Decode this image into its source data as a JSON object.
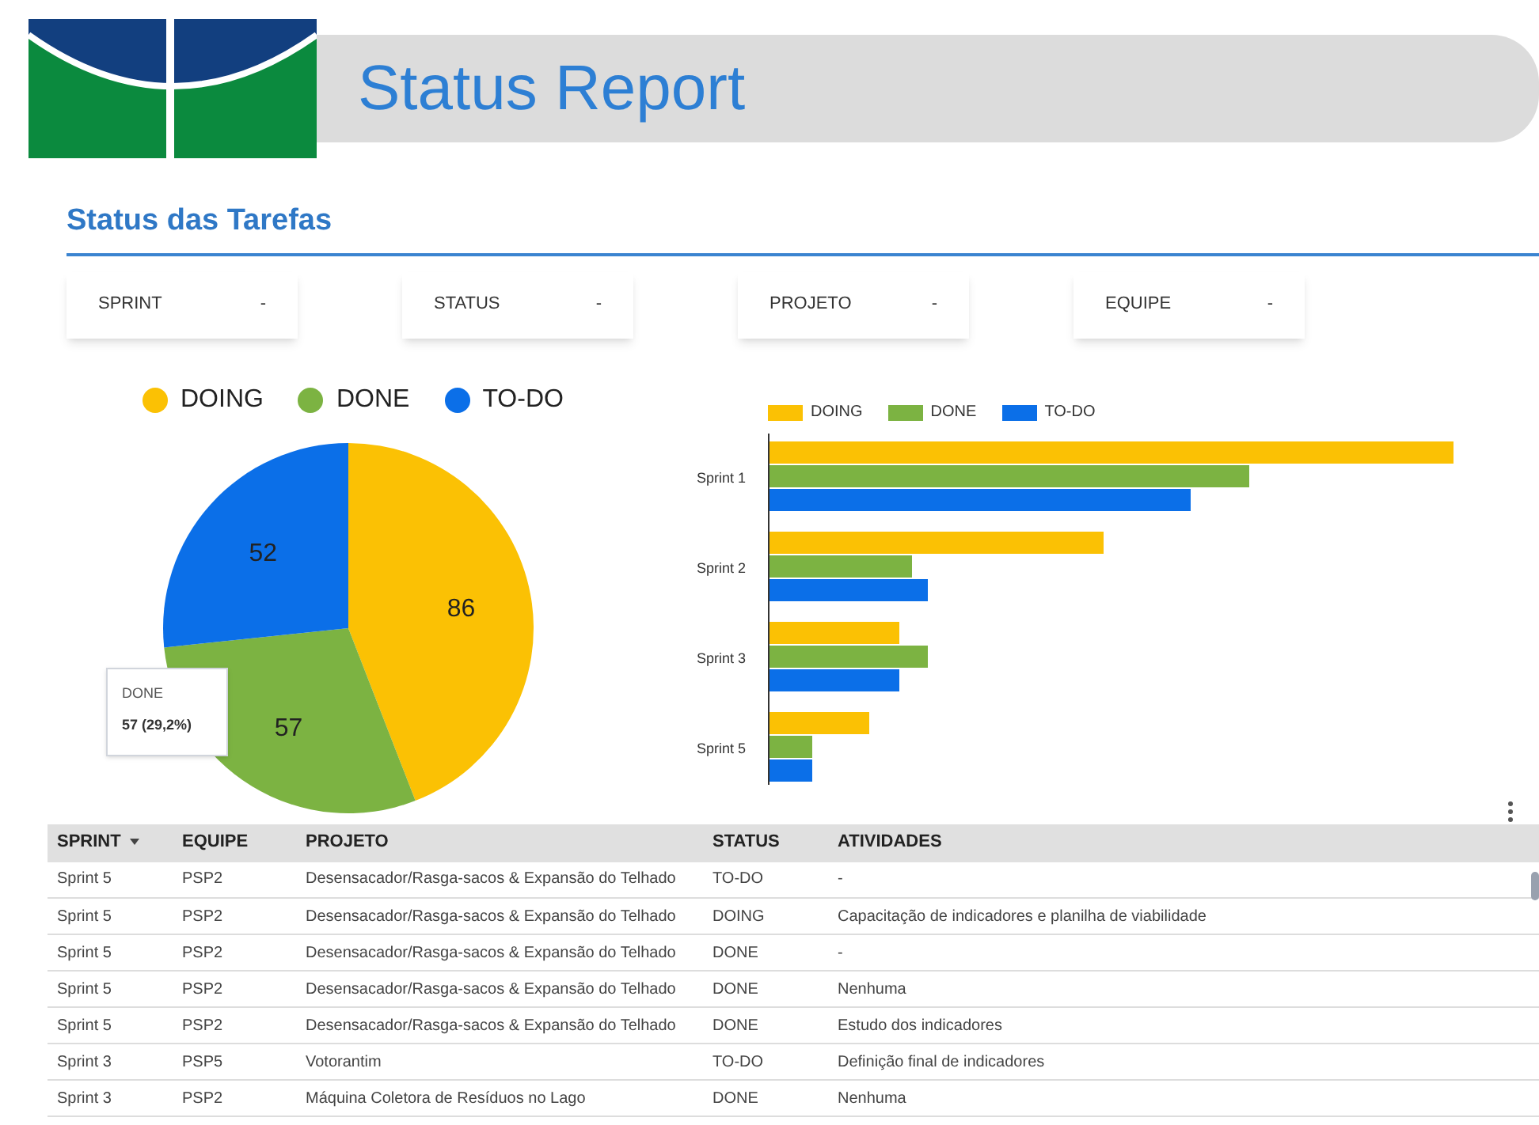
{
  "header": {
    "title": "Status Report"
  },
  "section": {
    "title": "Status das Tarefas"
  },
  "filters": [
    {
      "label": "SPRINT",
      "caret": "-"
    },
    {
      "label": "STATUS",
      "caret": "-"
    },
    {
      "label": "PROJETO",
      "caret": "-"
    },
    {
      "label": "EQUIPE",
      "caret": "-"
    }
  ],
  "pie": {
    "legend": [
      {
        "color": "#fbc104"
      },
      {
        "color": "#7cb342"
      },
      {
        "color": "#0b6fe8"
      }
    ],
    "chart_data": {
      "type": "pie",
      "categories": [
        "DOING",
        "DONE",
        "TO-DO"
      ],
      "series": [
        {
          "values": [
            86,
            57,
            52
          ]
        }
      ],
      "data_labels": true
    },
    "tooltip": {
      "title": "DONE",
      "value": "57 (29,2%)"
    }
  },
  "bars": {
    "legend": [
      {
        "label": "DOING",
        "color": "#fbc104"
      },
      {
        "label": "DONE",
        "color": "#7cb342"
      },
      {
        "label": "TO-DO",
        "color": "#0b6fe8"
      }
    ],
    "categories": [
      "Sprint 1",
      "Sprint 2",
      "Sprint 3",
      "Sprint 5"
    ]
  },
  "table": {
    "columns": [
      {
        "label": "SPRINT",
        "sorted": true
      },
      {
        "label": "EQUIPE",
        "sorted": false
      },
      {
        "label": "PROJETO",
        "sorted": false
      },
      {
        "label": "STATUS",
        "sorted": false
      },
      {
        "label": "ATIVIDADES",
        "sorted": false
      }
    ],
    "rows": [
      [
        "Sprint 5",
        "PSP2",
        "Desensacador/Rasga-sacos & Expansão do Telhado",
        "TO-DO",
        "-"
      ],
      [
        "Sprint 5",
        "PSP2",
        "Desensacador/Rasga-sacos & Expansão do Telhado",
        "DOING",
        "Capacitação de indicadores e planilha de viabilidade"
      ],
      [
        "Sprint 5",
        "PSP2",
        "Desensacador/Rasga-sacos & Expansão do Telhado",
        "DONE",
        "-"
      ],
      [
        "Sprint 5",
        "PSP2",
        "Desensacador/Rasga-sacos & Expansão do Telhado",
        "DONE",
        "Nenhuma"
      ],
      [
        "Sprint 5",
        "PSP2",
        "Desensacador/Rasga-sacos & Expansão do Telhado",
        "DONE",
        "Estudo dos indicadores"
      ],
      [
        "Sprint 3",
        "PSP5",
        "Votorantim",
        "TO-DO",
        "Definição final de indicadores"
      ],
      [
        "Sprint 3",
        "PSP2",
        "Máquina Coletora de Resíduos no Lago",
        "DONE",
        "Nenhuma"
      ]
    ]
  }
}
